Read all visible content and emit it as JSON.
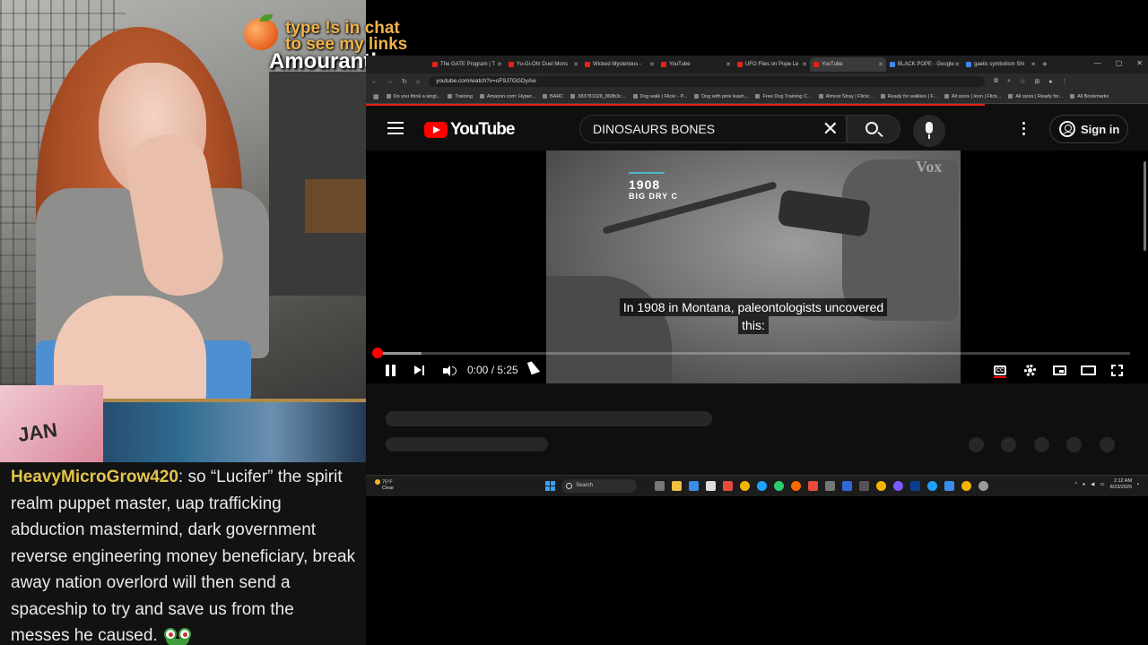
{
  "overlay": {
    "promo_line1": "type !s in chat",
    "promo_line2": "to see my links",
    "streamer_name": "Amouranth",
    "promo_icon": "peach-emoji"
  },
  "webcam": {
    "box_label": "JAN"
  },
  "chat": {
    "username": "HeavyMicroGrow420",
    "separator": ":",
    "message": " so “Lucifer” the spirit realm puppet master, uap trafficking abduction mastermind, dark government reverse engineering money beneficiary, break away nation overlord will then send a spaceship to try and save us from the messes he caused.",
    "emote": "bug-eyes-emote",
    "username_color": "#e3c44a"
  },
  "browser": {
    "tabs": [
      {
        "label": "The GATE Program | T",
        "icon": "youtube-favicon"
      },
      {
        "label": "Yu-Gi-Oh! Duel Mons",
        "icon": "youtube-favicon"
      },
      {
        "label": "Wicked Mysterious -",
        "icon": "youtube-favicon"
      },
      {
        "label": "YouTube",
        "icon": "youtube-favicon"
      },
      {
        "label": "UFO Files on Pope Le",
        "icon": "youtube-favicon"
      },
      {
        "label": "YouTube",
        "icon": "youtube-favicon",
        "active": true
      },
      {
        "label": "BLACK POPE - Google",
        "icon": "google-favicon"
      },
      {
        "label": "gaelic symbolism Shi",
        "icon": "google-favicon"
      }
    ],
    "url": "youtube.com/watch?v=oF9J7GGDyAw",
    "bookmarks": [
      "Do you think a singl...",
      "Training",
      "Amazon.com: Hyper...",
      "BARC",
      "383781028_868b3c...",
      "Dog walk | Flickr - P...",
      "Dog with pink leash...",
      "Free Dog Training C...",
      "Almost Stray | Flickr...",
      "Ready for walkies | F...",
      "All sizes | leon | Flick...",
      "All sizes | Ready for..."
    ],
    "all_bookmarks": "All Bookmarks"
  },
  "youtube": {
    "logo_text": "YouTube",
    "search_value": "DINOSAURS BONES",
    "sign_in": "Sign in",
    "accent": "#ff0000"
  },
  "video": {
    "year": "1908",
    "site": "BIG DRY C",
    "watermark": "Vox",
    "caption_line1": "In 1908 in Montana, paleontologists uncovered",
    "caption_line2": "this:",
    "time": "0:00 / 5:25",
    "progress_played": 0.0,
    "progress_buffered": 0.06
  },
  "taskbar": {
    "weather_temp": "75°F",
    "weather_desc": "Clear",
    "search_label": "Search",
    "time": "2:12 AM",
    "date": "8/23/2025"
  }
}
